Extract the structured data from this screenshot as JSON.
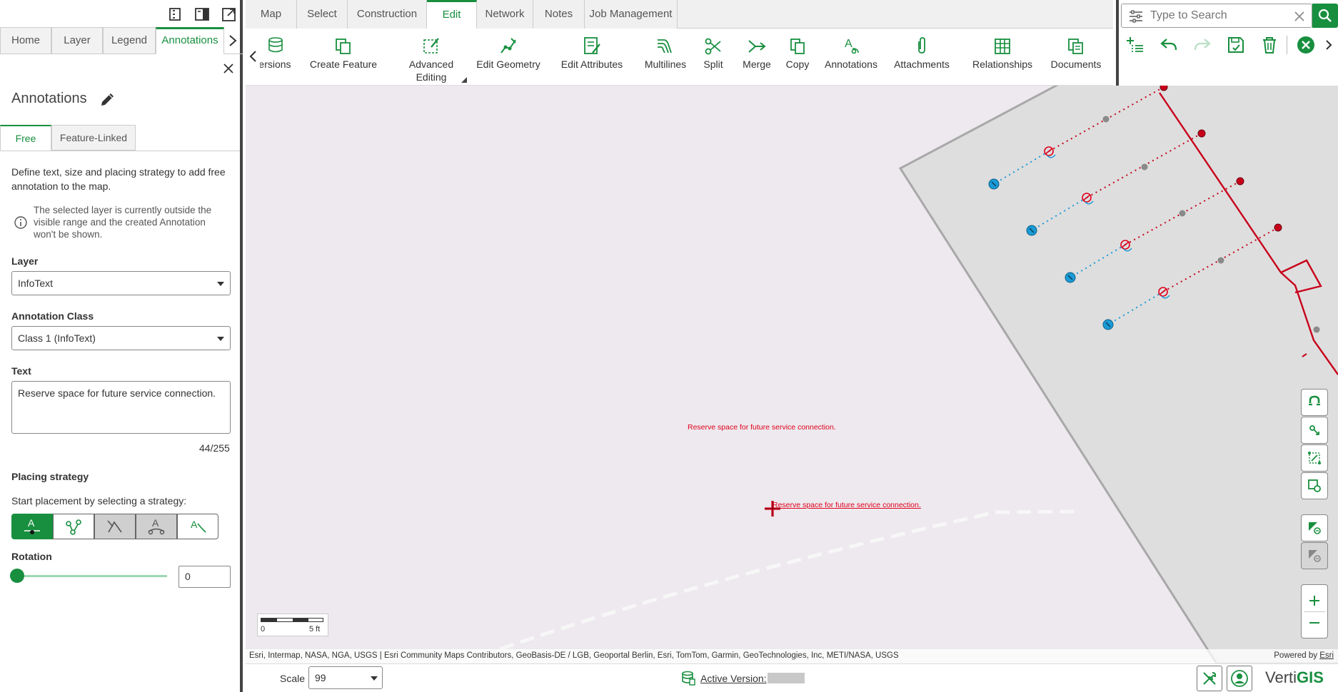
{
  "left_panel": {
    "tabs": [
      "Home",
      "Layer",
      "Legend",
      "Annotations"
    ],
    "title": "Annotations",
    "subtabs": [
      "Free",
      "Feature-Linked"
    ],
    "description": "Define text, size and placing strategy to add free annotation to the map.",
    "info_text": "The selected layer is currently outside the visible range and the created Annotation won't be shown.",
    "layer_label": "Layer",
    "layer_value": "InfoText",
    "class_label": "Annotation Class",
    "class_value": "Class 1 (InfoText)",
    "text_label": "Text",
    "text_value": "Reserve space for future service connection.",
    "char_count": "44/255",
    "placing_label": "Placing strategy",
    "placing_hint": "Start placement by selecting a strategy:",
    "rotation_label": "Rotation",
    "rotation_value": "0",
    "rotation_fraction": 0
  },
  "nav": {
    "tabs": [
      "Map",
      "Select",
      "Construction",
      "Edit",
      "Network",
      "Notes",
      "Job Management"
    ],
    "active_tab": "Edit"
  },
  "ribbon": {
    "partial_label": "ersions",
    "buttons": {
      "create_feature": "Create Feature",
      "advanced_editing_1": "Advanced",
      "advanced_editing_2": "Editing",
      "edit_geometry": "Edit Geometry",
      "edit_attributes": "Edit Attributes",
      "multilines": "Multilines",
      "split": "Split",
      "merge": "Merge",
      "copy": "Copy",
      "annotations": "Annotations",
      "attachments": "Attachments",
      "relationships": "Relationships",
      "documents": "Documents"
    }
  },
  "search": {
    "placeholder": "Type to Search"
  },
  "map": {
    "annotation_text_1": "Reserve space for future service connection.",
    "annotation_text_2": "Reserve space for future service connection.",
    "scale_min": "0",
    "scale_max": "5 ft",
    "attribution": "Esri, Intermap, NASA, NGA, USGS | Esri Community Maps Contributors, GeoBasis-DE / LGB, Geoportal Berlin, Esri, TomTom, Garmin, GeoTechnologies, Inc, METI/NASA, USGS",
    "powered_by": "Powered by ",
    "powered_by_link": "Esri"
  },
  "status": {
    "scale_label": "Scale",
    "scale_value": "99",
    "active_version_label": "Active Version:",
    "brand_1": "Verti",
    "brand_2": "GIS"
  },
  "colors": {
    "accent": "#188f3f",
    "annotation": "#e0001b",
    "pipe_red": "#c8001a",
    "service_blue": "#1a9ad6"
  }
}
